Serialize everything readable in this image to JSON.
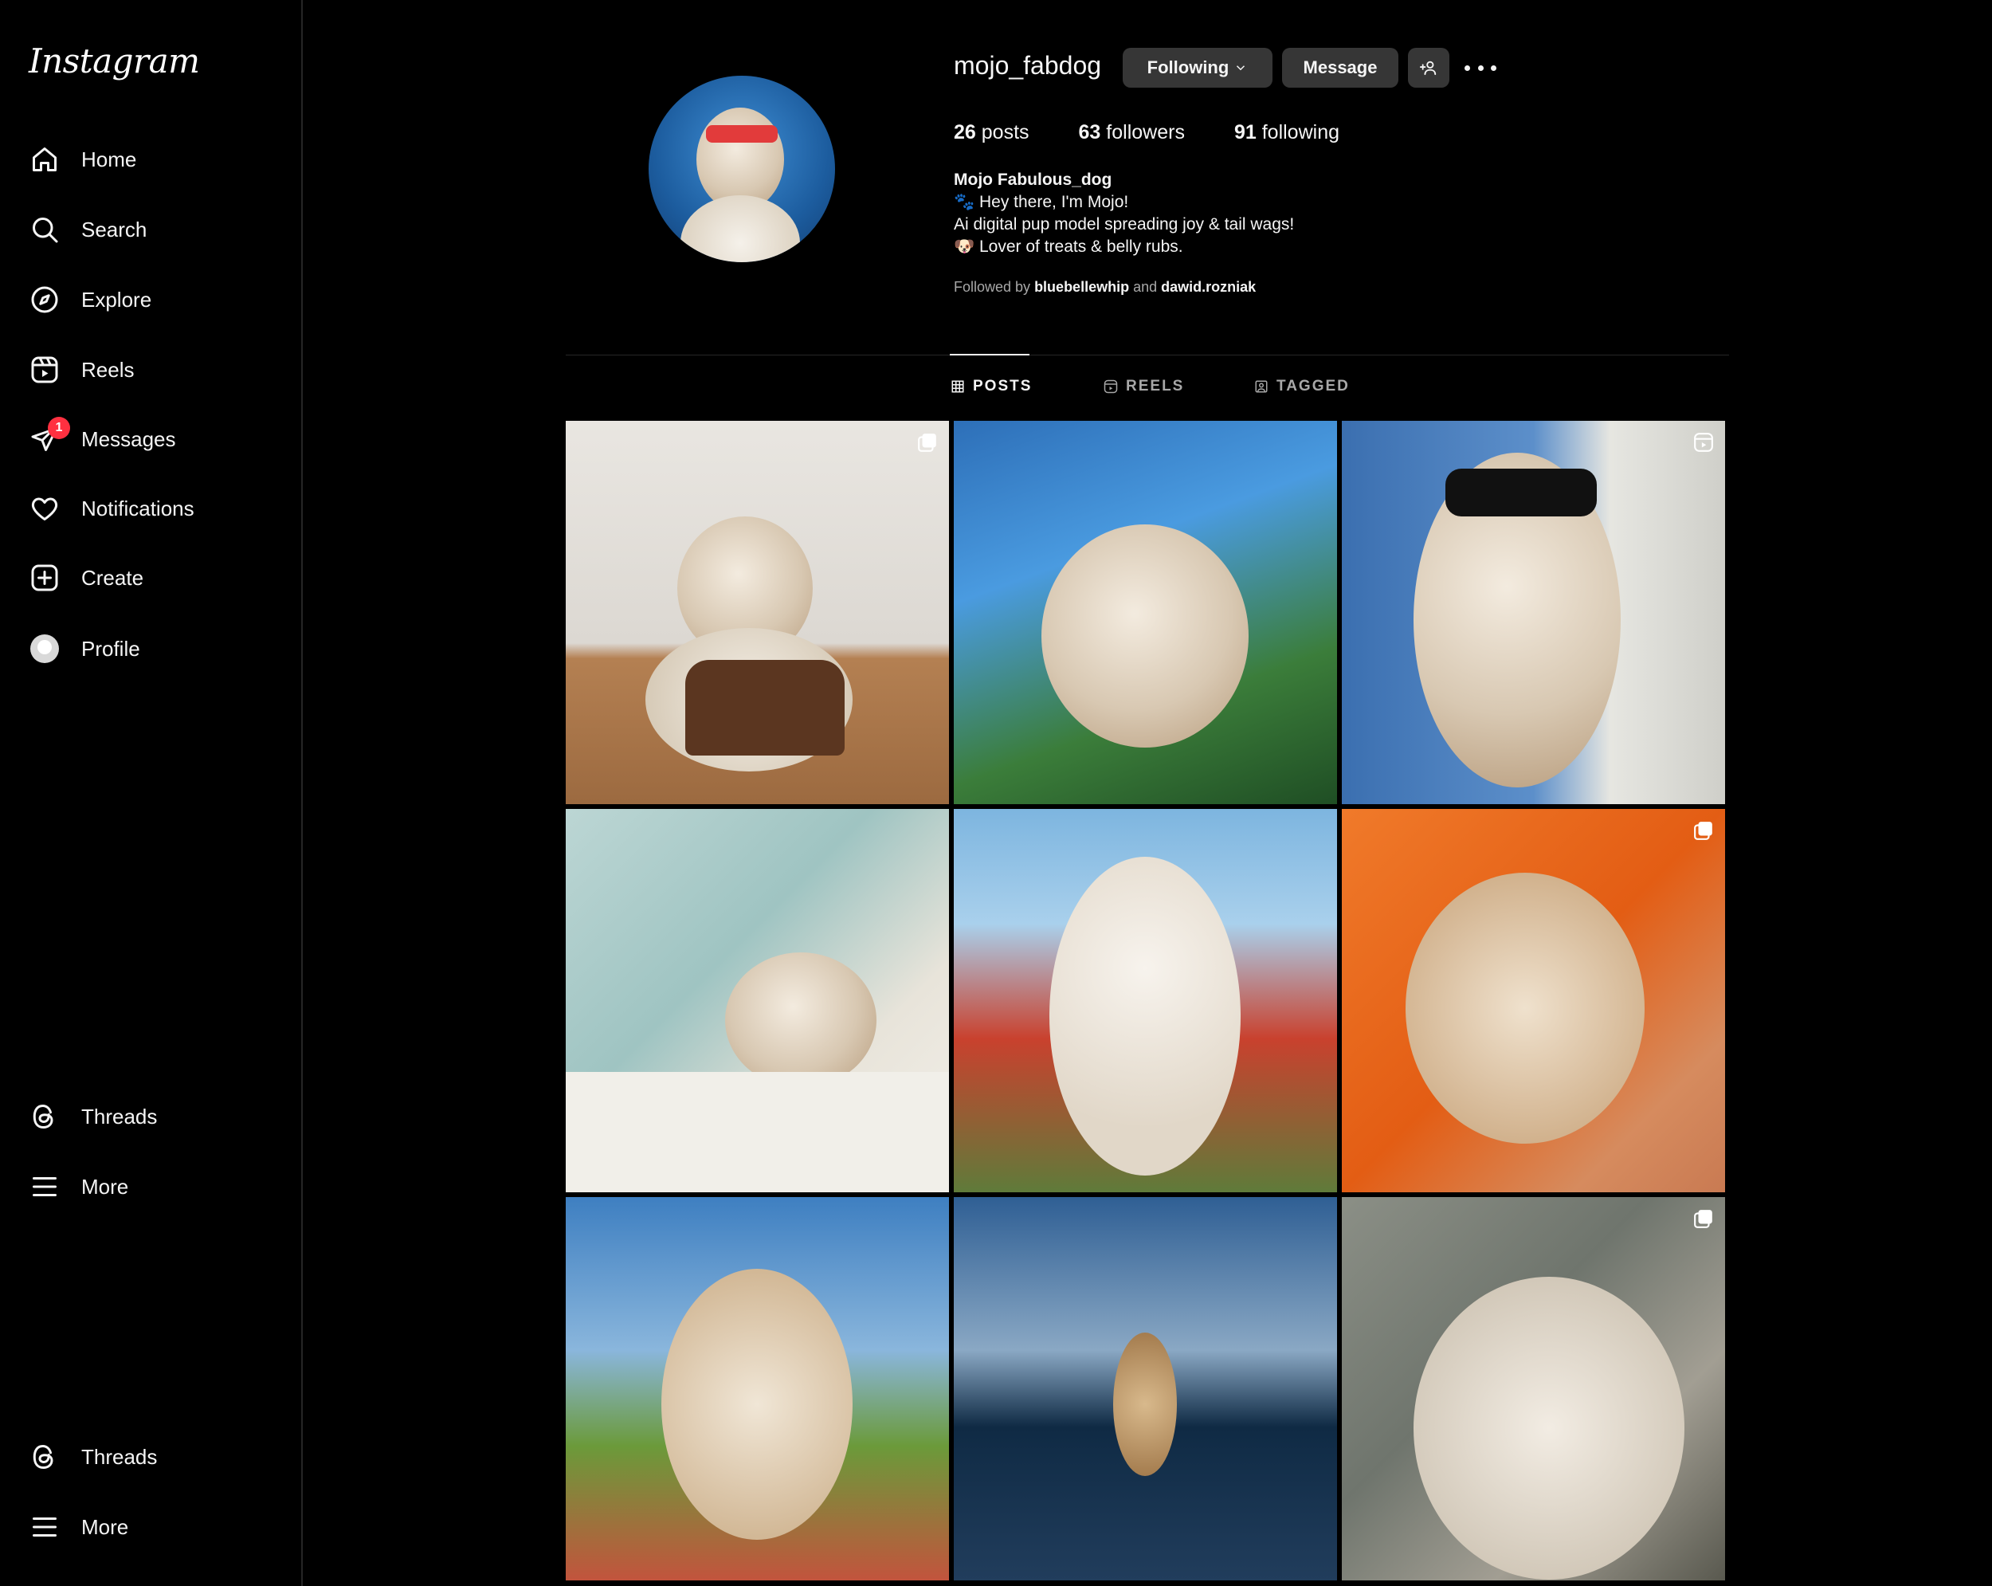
{
  "sidebar": {
    "logo": "Instagram",
    "items": [
      {
        "label": "Home",
        "icon": "home-icon"
      },
      {
        "label": "Search",
        "icon": "search-icon"
      },
      {
        "label": "Explore",
        "icon": "compass-icon"
      },
      {
        "label": "Reels",
        "icon": "reels-icon"
      },
      {
        "label": "Messages",
        "icon": "messenger-icon",
        "badge": "1"
      },
      {
        "label": "Notifications",
        "icon": "heart-icon"
      },
      {
        "label": "Create",
        "icon": "plus-square-icon"
      },
      {
        "label": "Profile",
        "icon": "avatar-icon"
      }
    ],
    "bottom_items": [
      {
        "label": "Threads",
        "icon": "threads-icon"
      },
      {
        "label": "More",
        "icon": "menu-icon"
      },
      {
        "label": "Threads",
        "icon": "threads-icon"
      },
      {
        "label": "More",
        "icon": "menu-icon"
      }
    ]
  },
  "profile": {
    "username": "mojo_fabdog",
    "following_label": "Following",
    "message_label": "Message",
    "stats": {
      "posts_count": "26",
      "posts_label": "posts",
      "followers_count": "63",
      "followers_label": "followers",
      "following_count": "91",
      "following_label": "following"
    },
    "bio": {
      "name": "Mojo Fabulous_dog",
      "line1": "🐾 Hey there, I'm Mojo!",
      "line2": "Ai digital pup model spreading joy & tail wags!",
      "line3": "🐶 Lover of treats & belly rubs."
    },
    "followed_by": {
      "prefix": "Followed by",
      "user1": "bluebellewhip",
      "conj": "and",
      "user2": "dawid.rozniak"
    }
  },
  "tabs": [
    {
      "label": "POSTS",
      "active": true
    },
    {
      "label": "REELS",
      "active": false
    },
    {
      "label": "TAGGED",
      "active": false
    }
  ],
  "colors": {
    "background": "#000000",
    "button": "#363636",
    "badge": "#ff3040",
    "muted_text": "#a8a8a8"
  }
}
